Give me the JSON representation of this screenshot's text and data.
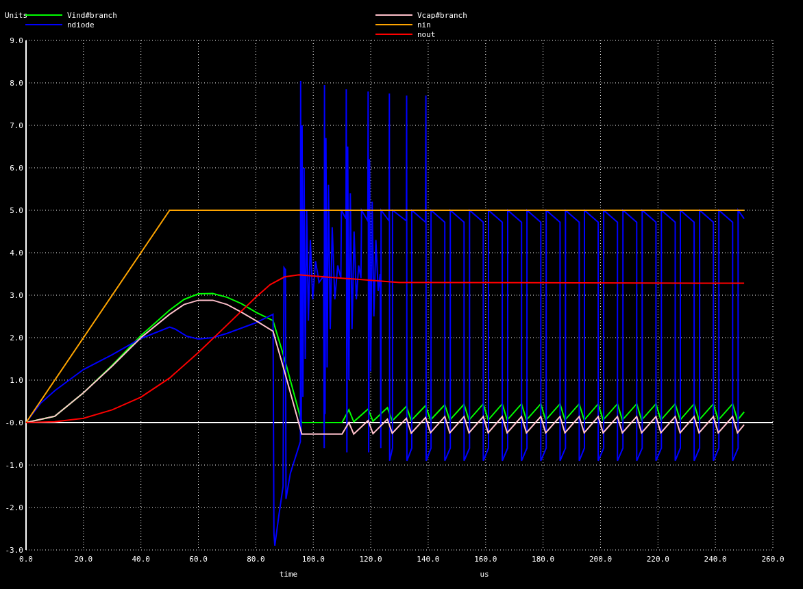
{
  "plot": {
    "x_unit": "us",
    "chart_data": {
      "type": "line",
      "grid": true,
      "legend": "top",
      "xlabel": "time",
      "ylabel": "Units",
      "xlim": [
        0,
        260
      ],
      "ylim": [
        -3,
        9
      ],
      "xticks": [
        {
          "value": 0,
          "label": "0.0"
        },
        {
          "value": 20,
          "label": "20.0"
        },
        {
          "value": 40,
          "label": "40.0"
        },
        {
          "value": 60,
          "label": "60.0"
        },
        {
          "value": 80,
          "label": "80.0"
        },
        {
          "value": 100,
          "label": "100.0"
        },
        {
          "value": 120,
          "label": "120.0"
        },
        {
          "value": 140,
          "label": "140.0"
        },
        {
          "value": 160,
          "label": "160.0"
        },
        {
          "value": 180,
          "label": "180.0"
        },
        {
          "value": 200,
          "label": "200.0"
        },
        {
          "value": 220,
          "label": "220.0"
        },
        {
          "value": 240,
          "label": "240.0"
        },
        {
          "value": 260,
          "label": "260.0"
        }
      ],
      "yticks": [
        {
          "value": -3,
          "label": "-3.0"
        },
        {
          "value": -2,
          "label": "-2.0"
        },
        {
          "value": -1,
          "label": "-1.0"
        },
        {
          "value": 0,
          "label": "-0.0"
        },
        {
          "value": 1,
          "label": "1.0"
        },
        {
          "value": 2,
          "label": "2.0"
        },
        {
          "value": 3,
          "label": "3.0"
        },
        {
          "value": 4,
          "label": "4.0"
        },
        {
          "value": 5,
          "label": "5.0"
        },
        {
          "value": 6,
          "label": "6.0"
        },
        {
          "value": 7,
          "label": "7.0"
        },
        {
          "value": 8,
          "label": "8.0"
        },
        {
          "value": 9,
          "label": "9.0"
        }
      ],
      "series": [
        {
          "name": "Vind#branch",
          "color": "#00ff00",
          "x": [
            0,
            10,
            20,
            30,
            40,
            50,
            55,
            60,
            65,
            70,
            75,
            80,
            86,
            90,
            96,
            110,
            112.4,
            114.1,
            119.1,
            120.8,
            125.8,
            127.5,
            132.4,
            134.1,
            139.1,
            140.8,
            145.8,
            147.5,
            152.5,
            154.2,
            159.2,
            160.9,
            165.8,
            167.5,
            172.5,
            174.2,
            179.2,
            180.9,
            185.9,
            187.6,
            192.6,
            194.3,
            199.2,
            200.9,
            205.9,
            207.6,
            212.6,
            214.3,
            219.3,
            221,
            226,
            227.7,
            232.6,
            234.3,
            239.3,
            241,
            246,
            247.7,
            250
          ],
          "values": [
            0,
            0.15,
            0.7,
            1.35,
            2.05,
            2.65,
            2.9,
            3.03,
            3.04,
            2.95,
            2.8,
            2.6,
            2.4,
            1.5,
            0,
            0,
            0.3,
            0.02,
            0.32,
            0.03,
            0.35,
            0.04,
            0.38,
            0.05,
            0.4,
            0.06,
            0.42,
            0.06,
            0.43,
            0.06,
            0.44,
            0.06,
            0.44,
            0.06,
            0.44,
            0.06,
            0.44,
            0.06,
            0.44,
            0.06,
            0.44,
            0.06,
            0.44,
            0.06,
            0.44,
            0.06,
            0.44,
            0.06,
            0.44,
            0.06,
            0.44,
            0.06,
            0.44,
            0.06,
            0.44,
            0.06,
            0.44,
            0.06,
            0.25
          ]
        },
        {
          "name": "ndiode",
          "color": "#0000ff",
          "x": [
            0,
            5,
            10,
            20,
            30,
            40,
            50,
            52,
            56,
            60,
            65,
            70,
            80,
            86,
            86.3,
            86.6,
            88,
            89.5,
            89.8,
            90.3,
            90.5,
            92,
            95.5,
            95.6,
            95.8,
            96.1,
            96.4,
            96.8,
            97.2,
            97.7,
            98.3,
            99,
            99.8,
            100.8,
            102,
            103.6,
            103.8,
            103.9,
            104.1,
            104.4,
            104.8,
            105.3,
            105.9,
            106.6,
            107.5,
            108.5,
            109.6,
            109.8,
            111.4,
            111.5,
            111.7,
            112,
            112.4,
            112.9,
            113.5,
            114.2,
            115,
            115.8,
            116.6,
            116.8,
            119,
            119.1,
            119.3,
            119.6,
            120,
            120.5,
            121.1,
            121.8,
            122.6,
            123.3,
            123.5,
            123.6,
            126.4,
            126.5,
            126.6,
            127.6,
            127.6,
            132.4,
            132.5,
            132.6,
            134.3,
            134.3,
            139.1,
            139.2,
            139.3,
            141,
            141,
            145.8,
            145.8,
            147.7,
            147.7,
            152.5,
            152.5,
            154.4,
            154.4,
            159.2,
            159.2,
            161,
            161,
            165.8,
            165.8,
            167.7,
            167.7,
            172.5,
            172.5,
            174.4,
            174.4,
            179.2,
            179.2,
            181.1,
            181.1,
            185.9,
            185.9,
            187.8,
            187.8,
            192.6,
            192.6,
            194.4,
            194.4,
            199.2,
            199.2,
            201.1,
            201.1,
            205.9,
            205.9,
            207.8,
            207.8,
            212.6,
            212.6,
            214.5,
            214.5,
            219.3,
            219.3,
            221.2,
            221.2,
            226,
            226,
            227.8,
            227.8,
            232.6,
            232.6,
            234.5,
            234.5,
            239.3,
            239.3,
            241.2,
            241.2,
            246,
            246,
            247.9,
            247.9,
            250
          ],
          "values": [
            0,
            0.45,
            0.75,
            1.25,
            1.6,
            1.98,
            2.25,
            2.2,
            2.03,
            1.97,
            2,
            2.1,
            2.35,
            2.55,
            -2.6,
            -2.9,
            -2.2,
            -1.5,
            3.65,
            3.6,
            -1.8,
            -1.2,
            -0.45,
            8.05,
            -0.3,
            7,
            0.6,
            6,
            1.5,
            5,
            2.4,
            4.3,
            2.9,
            3.8,
            3.3,
            3.45,
            -0.6,
            7.95,
            0.2,
            6.7,
            1.3,
            5.6,
            2.2,
            4.6,
            2.9,
            3.7,
            3.4,
            5,
            4.8,
            7.85,
            -0.7,
            6.5,
            1,
            5.4,
            2.2,
            4.5,
            2.9,
            3.7,
            3.4,
            5,
            4.75,
            7.8,
            -0.7,
            6.2,
            1.2,
            5.2,
            2.5,
            4.3,
            3.1,
            3.5,
            -0.6,
            5,
            4.75,
            7.75,
            -0.9,
            -0.6,
            5,
            4.75,
            7.7,
            -0.9,
            -0.6,
            5,
            4.72,
            7.7,
            -0.9,
            -0.6,
            5,
            4.72,
            -0.9,
            -0.6,
            5,
            4.72,
            -0.9,
            -0.6,
            5,
            4.72,
            -0.9,
            -0.6,
            5,
            4.72,
            -0.9,
            -0.6,
            5,
            4.72,
            -0.9,
            -0.6,
            5,
            4.72,
            -0.9,
            -0.6,
            5,
            4.72,
            -0.9,
            -0.6,
            5,
            4.72,
            -0.9,
            -0.6,
            5,
            4.72,
            -0.9,
            -0.6,
            5,
            4.72,
            -0.9,
            -0.6,
            5,
            4.72,
            -0.9,
            -0.6,
            5,
            4.72,
            -0.9,
            -0.6,
            5,
            4.72,
            -0.9,
            -0.6,
            5,
            4.72,
            -0.9,
            -0.6,
            5,
            4.72,
            -0.9,
            -0.6,
            5,
            4.72,
            -0.9,
            -0.6,
            5,
            4.8
          ]
        },
        {
          "name": "Vcap#branch",
          "color": "#ffc0cb",
          "x": [
            0,
            10,
            20,
            30,
            40,
            50,
            55,
            60,
            65,
            70,
            75,
            80,
            86,
            90,
            96,
            110,
            112.4,
            114.1,
            119.1,
            120.8,
            125.8,
            127.5,
            132.4,
            134.1,
            139.1,
            140.8,
            145.8,
            147.5,
            152.5,
            154.2,
            159.2,
            160.9,
            165.8,
            167.5,
            172.5,
            174.2,
            179.2,
            180.9,
            185.9,
            187.6,
            192.6,
            194.3,
            199.2,
            200.9,
            205.9,
            207.6,
            212.6,
            214.3,
            219.3,
            221,
            226,
            227.7,
            232.6,
            234.3,
            239.3,
            241,
            246,
            247.7,
            250
          ],
          "values": [
            0,
            0.15,
            0.7,
            1.33,
            2,
            2.55,
            2.78,
            2.88,
            2.88,
            2.78,
            2.6,
            2.4,
            2.15,
            1.2,
            -0.27,
            -0.27,
            0,
            -0.27,
            0.05,
            -0.26,
            0.08,
            -0.25,
            0.1,
            -0.25,
            0.12,
            -0.24,
            0.14,
            -0.24,
            0.14,
            -0.24,
            0.14,
            -0.24,
            0.14,
            -0.24,
            0.14,
            -0.24,
            0.14,
            -0.24,
            0.14,
            -0.24,
            0.14,
            -0.24,
            0.14,
            -0.24,
            0.14,
            -0.24,
            0.14,
            -0.24,
            0.14,
            -0.24,
            0.14,
            -0.24,
            0.14,
            -0.24,
            0.14,
            -0.24,
            0.14,
            -0.24,
            -0.05
          ]
        },
        {
          "name": "nin",
          "color": "#ffa500",
          "x": [
            0,
            50,
            250
          ],
          "values": [
            0,
            5,
            5
          ]
        },
        {
          "name": "nout",
          "color": "#ff0000",
          "x": [
            0,
            10,
            20,
            30,
            40,
            50,
            60,
            70,
            80,
            85,
            90,
            95,
            100,
            110,
            120,
            130,
            140,
            250
          ],
          "values": [
            0,
            0.02,
            0.1,
            0.3,
            0.6,
            1.05,
            1.65,
            2.3,
            2.95,
            3.25,
            3.43,
            3.48,
            3.45,
            3.4,
            3.35,
            3.3,
            3.3,
            3.28
          ]
        }
      ]
    }
  }
}
